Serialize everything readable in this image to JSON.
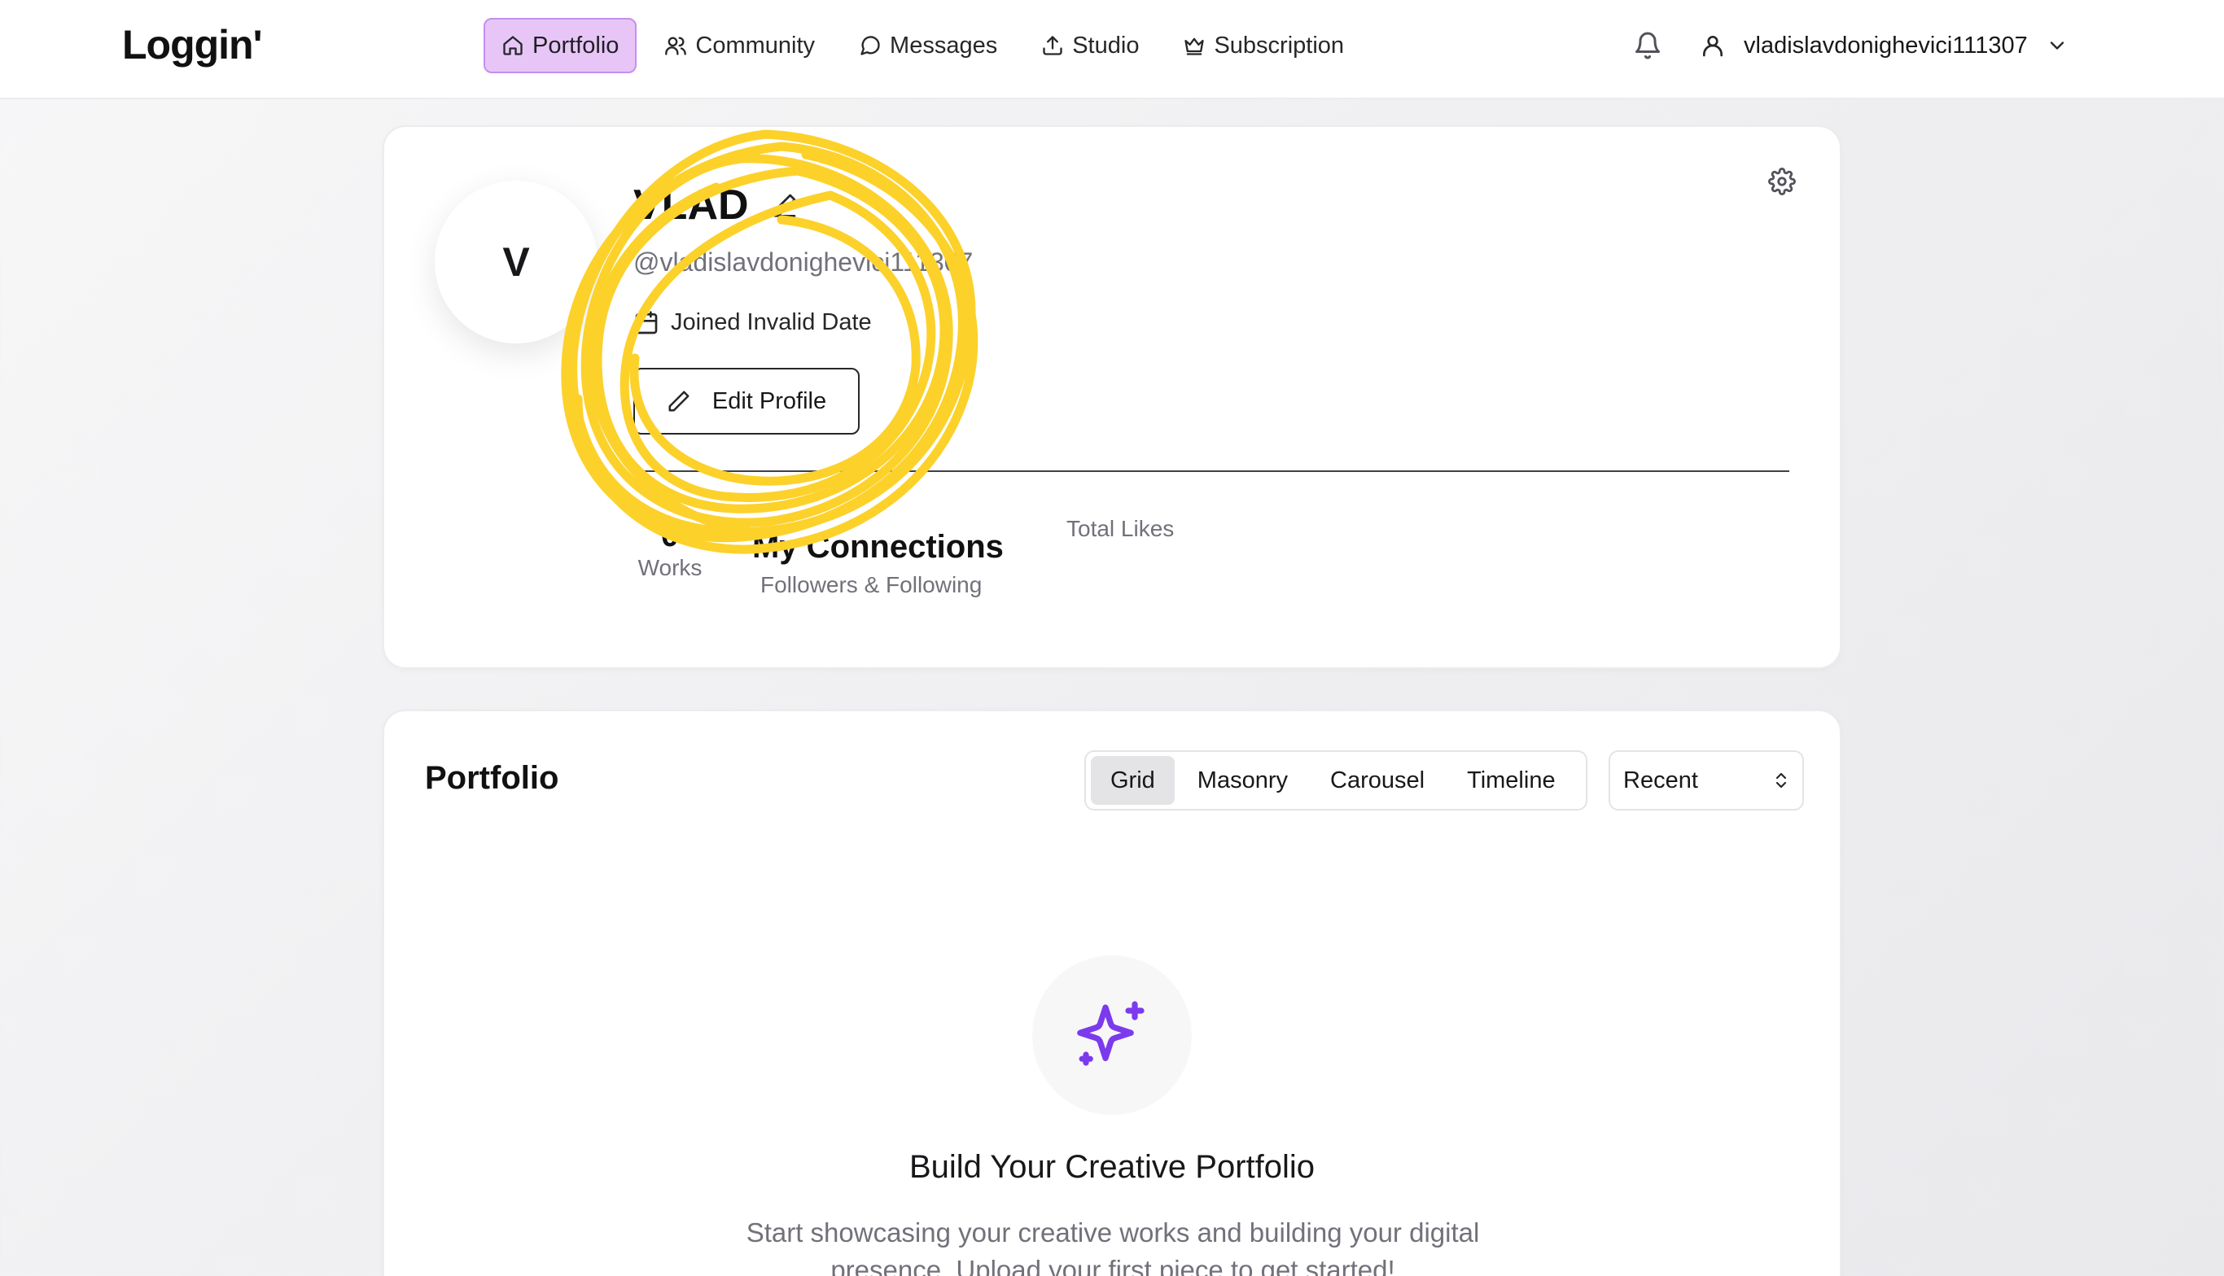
{
  "app": {
    "brand": "Loggin'"
  },
  "nav": {
    "items": [
      {
        "label": "Portfolio",
        "icon": "home-icon",
        "active": true
      },
      {
        "label": "Community",
        "icon": "users-icon",
        "active": false
      },
      {
        "label": "Messages",
        "icon": "message-circle-icon",
        "active": false
      },
      {
        "label": "Studio",
        "icon": "upload-icon",
        "active": false
      },
      {
        "label": "Subscription",
        "icon": "crown-icon",
        "active": false
      }
    ],
    "username": "vladislavdonighevici111307"
  },
  "profile": {
    "avatar_initial": "V",
    "display_name": "VLAD",
    "handle": "@vladislavdonighevici111307",
    "joined": "Joined Invalid Date",
    "edit_label": "Edit Profile",
    "stats": {
      "works_count": "0",
      "works_label": "Works",
      "connections_title": "My Connections",
      "connections_sub": "Followers & Following",
      "likes_label": "Total Likes"
    }
  },
  "portfolio": {
    "title": "Portfolio",
    "views": [
      "Grid",
      "Masonry",
      "Carousel",
      "Timeline"
    ],
    "selected_view": "Grid",
    "sort": "Recent",
    "empty_title": "Build Your Creative Portfolio",
    "empty_desc": "Start showcasing your creative works and building your digital presence. Upload your first piece to get started!"
  },
  "colors": {
    "active_nav_bg": "#e7c6f7",
    "active_nav_border": "#c58ef0",
    "sparkle": "#7c3aed",
    "annotation": "#fcd12a"
  }
}
